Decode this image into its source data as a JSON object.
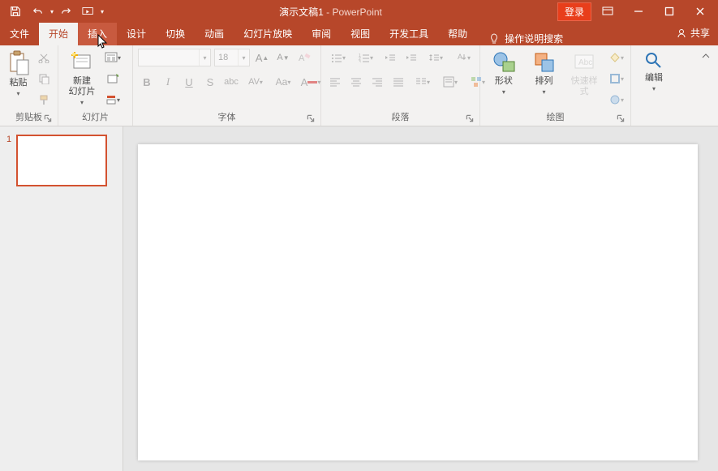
{
  "title": {
    "document": "演示文稿1",
    "separator": " - ",
    "app": "PowerPoint"
  },
  "login_label": "登录",
  "tabs": {
    "file": "文件",
    "home": "开始",
    "insert": "插入",
    "design": "设计",
    "transitions": "切换",
    "animations": "动画",
    "slideshow": "幻灯片放映",
    "review": "审阅",
    "view": "视图",
    "developer": "开发工具",
    "help": "帮助",
    "tellme": "操作说明搜索",
    "share": "共享"
  },
  "groups": {
    "clipboard": {
      "label": "剪贴板",
      "paste": "粘贴"
    },
    "slides": {
      "label": "幻灯片",
      "new_slide": "新建\n幻灯片"
    },
    "font": {
      "label": "字体",
      "font_name": "",
      "font_size": "18"
    },
    "paragraph": {
      "label": "段落"
    },
    "drawing": {
      "label": "绘图",
      "shapes": "形状",
      "arrange": "排列",
      "quick_styles": "快速样式"
    },
    "editing": {
      "label": "编辑"
    }
  },
  "thumb": {
    "num": "1"
  }
}
